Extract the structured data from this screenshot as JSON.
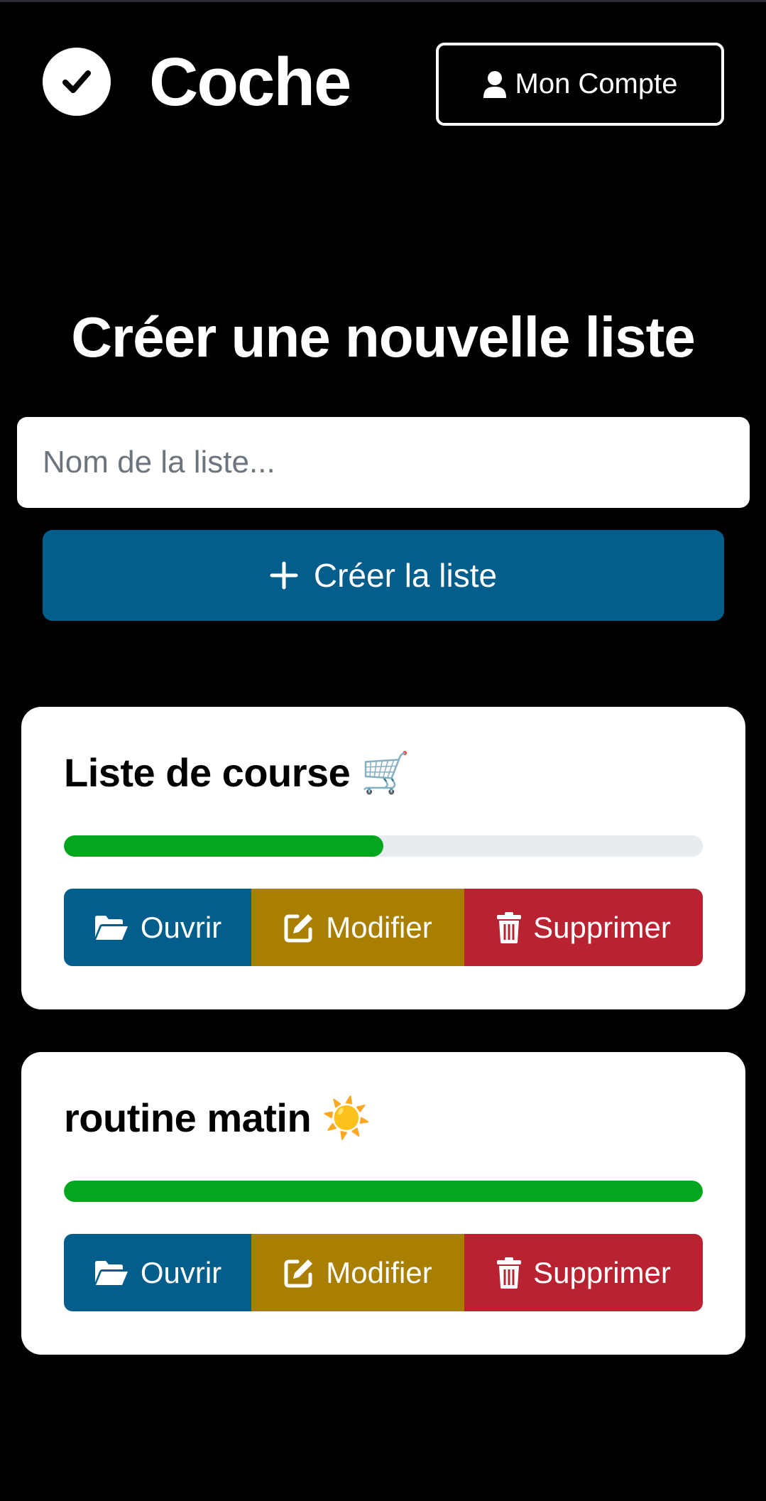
{
  "app": {
    "brand": "Coche",
    "account_label": "Mon Compte"
  },
  "create": {
    "title": "Créer une nouvelle liste",
    "input_placeholder": "Nom de la liste...",
    "input_value": "",
    "button_label": "Créer la liste"
  },
  "lists": [
    {
      "title": "Liste de course 🛒",
      "progress": 0.5,
      "open_label": "Ouvrir",
      "edit_label": "Modifier",
      "delete_label": "Supprimer"
    },
    {
      "title": "routine matin ☀️",
      "progress": 1.0,
      "open_label": "Ouvrir",
      "edit_label": "Modifier",
      "delete_label": "Supprimer"
    }
  ],
  "icons": {
    "logo": "check-circle-icon",
    "account": "user-icon",
    "create": "plus-icon",
    "open": "folder-open-icon",
    "edit": "edit-icon",
    "delete": "trash-icon"
  },
  "colors": {
    "background": "#000000",
    "primary": "#045e8c",
    "warning": "#a87f00",
    "danger": "#b82231",
    "success": "#04a61e",
    "progress_track": "#e9ecef"
  }
}
